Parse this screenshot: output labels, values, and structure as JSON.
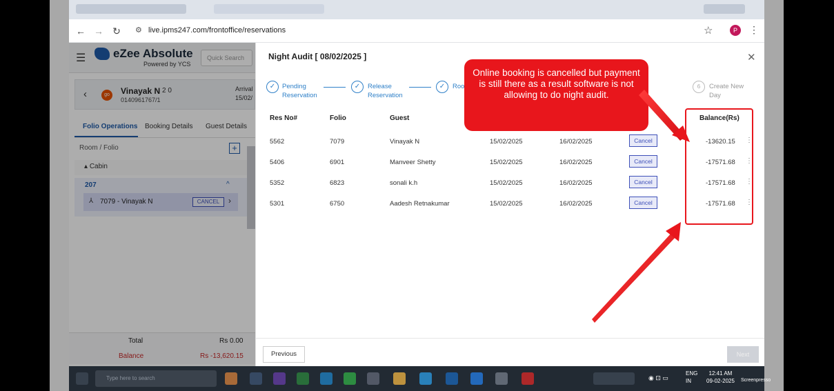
{
  "browser": {
    "url": "live.ipms247.com/frontoffice/reservations",
    "profile_initial": "P"
  },
  "app": {
    "brand": "eZee Absolute",
    "brand_sub": "Powered by YCS",
    "quick_search_placeholder": "Quick Search",
    "guest": {
      "initials": "go",
      "name": "Vinayak N",
      "pax": "2   0",
      "id": "0140961767/1",
      "arrival_label": "Arrival",
      "arrival_date": "15/02/"
    },
    "left_tabs": [
      "Folio Operations",
      "Booking Details",
      "Guest Details"
    ],
    "room_folio_label": "Room / Folio",
    "cabin_label": "Cabin",
    "room_no": "207",
    "room_item": "7079 - Vinayak N",
    "room_cancel": "CANCEL",
    "total_label": "Total",
    "total_value": "Rs 0.00",
    "balance_label": "Balance",
    "balance_value": "Rs -13,620.15"
  },
  "modal": {
    "title": "Night Audit [ 08/02/2025 ]",
    "steps": [
      {
        "label": "Pending\nReservation"
      },
      {
        "label": "Release\nReservation"
      },
      {
        "label": "Roo"
      },
      {
        "number": "6",
        "label": "Create New\nDay"
      }
    ],
    "columns": [
      "Res No#",
      "Folio",
      "Guest",
      "Balance(Rs)"
    ],
    "rows": [
      {
        "res": "5562",
        "folio": "7079",
        "guest": "Vinayak N",
        "arrival": "15/02/2025",
        "departure": "16/02/2025",
        "action": "Cancel",
        "balance": "-13620.15"
      },
      {
        "res": "5406",
        "folio": "6901",
        "guest": "Manveer Shetty",
        "arrival": "15/02/2025",
        "departure": "16/02/2025",
        "action": "Cancel",
        "balance": "-17571.68"
      },
      {
        "res": "5352",
        "folio": "6823",
        "guest": "sonali k.h",
        "arrival": "15/02/2025",
        "departure": "16/02/2025",
        "action": "Cancel",
        "balance": "-17571.68"
      },
      {
        "res": "5301",
        "folio": "6750",
        "guest": "Aadesh Retnakumar",
        "arrival": "15/02/2025",
        "departure": "16/02/2025",
        "action": "Cancel",
        "balance": "-17571.68"
      }
    ],
    "previous_label": "Previous",
    "next_label": "Next"
  },
  "annotation": {
    "text": "Online booking is cancelled but payment is still there as a result software is not allowing to do night audit.",
    "color": "#e8161c"
  },
  "taskbar": {
    "search_placeholder": "Type here to search",
    "lang": "ENG",
    "region": "IN",
    "time": "12:41 AM",
    "date": "09-02-2025"
  },
  "watermark": "Screenpresso"
}
